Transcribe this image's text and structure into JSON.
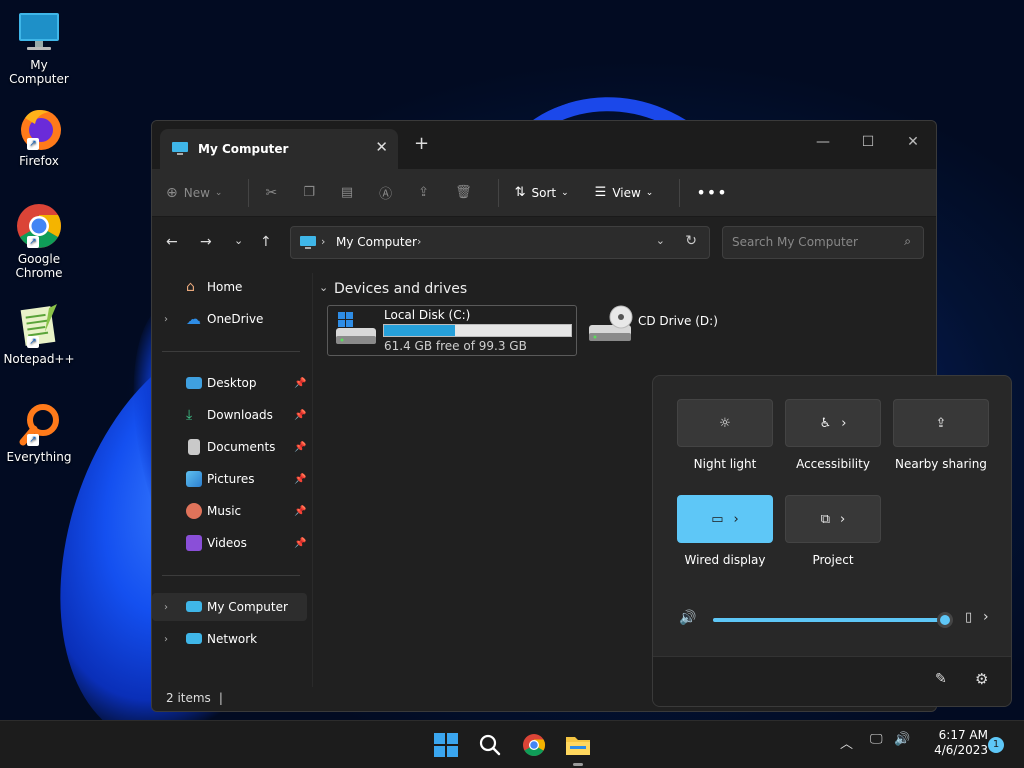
{
  "desktop": {
    "icons": [
      {
        "label": "My Computer"
      },
      {
        "label": "Firefox"
      },
      {
        "label": "Google Chrome"
      },
      {
        "label": "Notepad++"
      },
      {
        "label": "Everything"
      }
    ]
  },
  "explorer": {
    "tab_title": "My Computer",
    "toolbar": {
      "new_label": "New",
      "sort_label": "Sort",
      "view_label": "View"
    },
    "address": {
      "breadcrumb": "My Computer"
    },
    "search": {
      "placeholder": "Search My Computer"
    },
    "sidebar": {
      "items": [
        {
          "label": "Home"
        },
        {
          "label": "OneDrive"
        },
        {
          "label": "Desktop"
        },
        {
          "label": "Downloads"
        },
        {
          "label": "Documents"
        },
        {
          "label": "Pictures"
        },
        {
          "label": "Music"
        },
        {
          "label": "Videos"
        },
        {
          "label": "My Computer"
        },
        {
          "label": "Network"
        }
      ]
    },
    "section_title": "Devices and drives",
    "drives": [
      {
        "name": "Local Disk (C:)",
        "free_text": "61.4 GB free of 99.3 GB",
        "used_fraction": 0.38
      },
      {
        "name": "CD Drive (D:)"
      }
    ],
    "status": "2 items"
  },
  "quick_settings": {
    "tiles": [
      {
        "label": "Night light",
        "active": false
      },
      {
        "label": "Accessibility",
        "active": false
      },
      {
        "label": "Nearby sharing",
        "active": false
      },
      {
        "label": "Wired display",
        "active": true
      },
      {
        "label": "Project",
        "active": false
      }
    ],
    "volume_level": 1.0,
    "accent_color": "#5ec7f7"
  },
  "taskbar": {
    "time": "6:17 AM",
    "date": "4/6/2023",
    "notification_count": "1"
  }
}
